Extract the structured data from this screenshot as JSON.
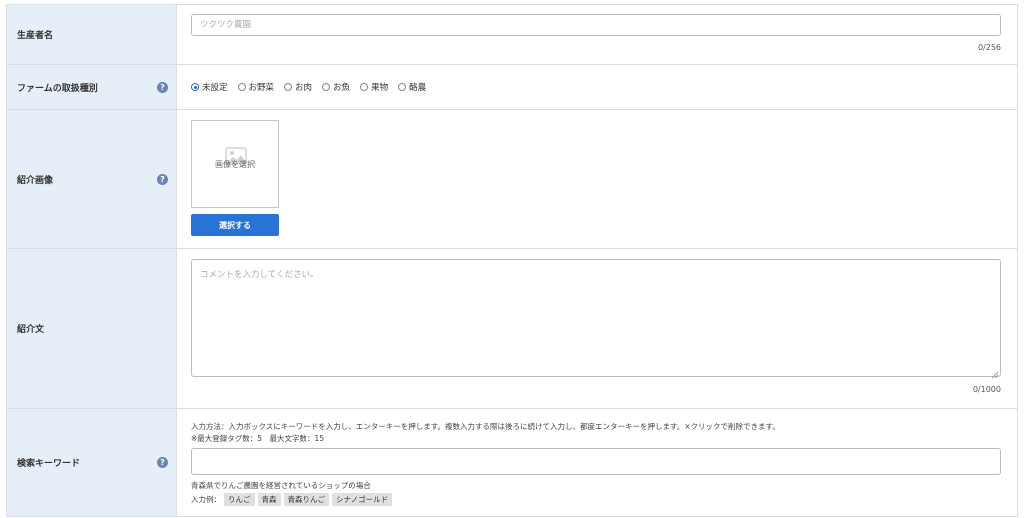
{
  "producer": {
    "label": "生産者名",
    "placeholder": "ツクツク農園",
    "value": "",
    "counter": "0/256"
  },
  "farm_type": {
    "label": "ファームの取扱種別",
    "help": "?",
    "options": [
      "未設定",
      "お野菜",
      "お肉",
      "お魚",
      "果物",
      "酪農"
    ],
    "selected": "未設定"
  },
  "intro_image": {
    "label": "紹介画像",
    "help": "?",
    "placeholder": "画像を選択",
    "button": "選択する"
  },
  "intro_text": {
    "label": "紹介文",
    "placeholder": "コメントを入力してください。",
    "value": "",
    "counter": "0/1000"
  },
  "keywords": {
    "label": "検索キーワード",
    "help": "?",
    "instruction": "入力方法：入力ボックスにキーワードを入力し、エンターキーを押します。複数入力する際は後ろに続けて入力し、都度エンターキーを押します。×クリックで削除できます。",
    "limits": "※最大登録タグ数：5　最大文字数：15",
    "value": "",
    "example_note": "青森県でりんご農園を経営されているショップの場合",
    "example_label": "入力例：",
    "example_tags": [
      "りんご",
      "青森",
      "青森りんご",
      "シナノゴールド"
    ]
  },
  "colors": {
    "label_bg": "#e6eef7",
    "accent": "#2a73d6",
    "help_icon": "#6c85b0"
  }
}
